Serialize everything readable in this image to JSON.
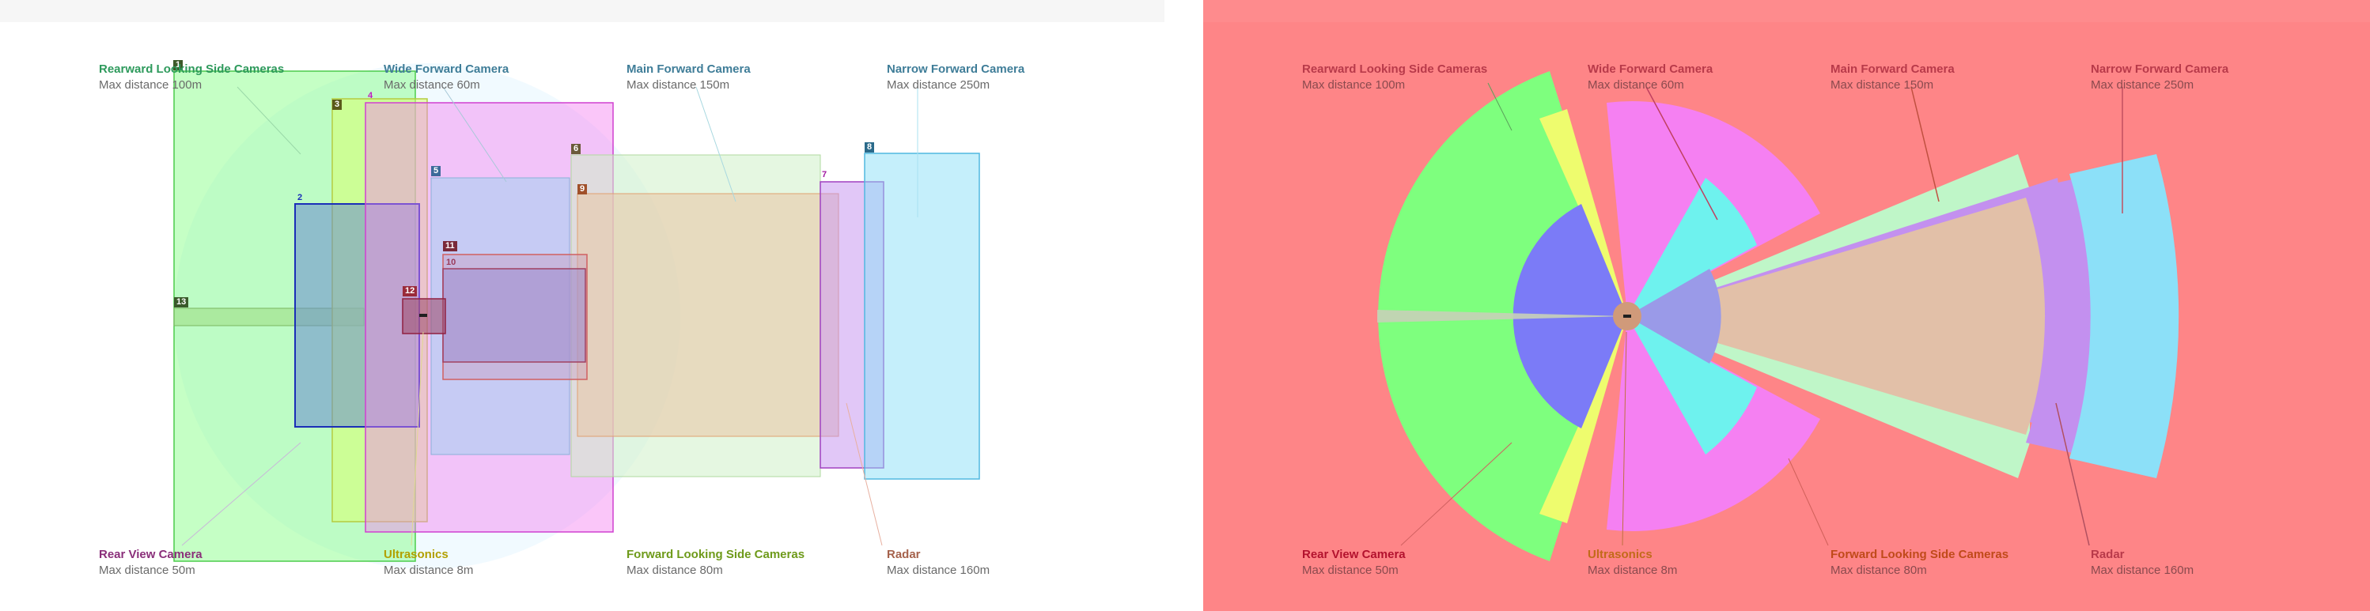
{
  "labels": [
    {
      "id": "rear-side",
      "name": "Rearward Looking Side Cameras",
      "dist": "Max distance 100m",
      "color": "#2e9a5c"
    },
    {
      "id": "wide",
      "name": "Wide Forward Camera",
      "dist": "Max distance 60m",
      "color": "#3f7d98"
    },
    {
      "id": "main",
      "name": "Main Forward Camera",
      "dist": "Max distance 150m",
      "color": "#3f7d98"
    },
    {
      "id": "narrow",
      "name": "Narrow Forward Camera",
      "dist": "Max distance 250m",
      "color": "#3f7d98"
    },
    {
      "id": "rear-view",
      "name": "Rear View Camera",
      "dist": "Max distance 50m",
      "color": "#8a2f7a"
    },
    {
      "id": "ultrasonics",
      "name": "Ultrasonics",
      "dist": "Max distance 8m",
      "color": "#b2a000"
    },
    {
      "id": "fwd-side",
      "name": "Forward Looking Side Cameras",
      "dist": "Max distance 80m",
      "color": "#6e9a1a"
    },
    {
      "id": "radar",
      "name": "Radar",
      "dist": "Max distance 160m",
      "color": "#a5624c"
    }
  ],
  "right_label_colors": {
    "rear-side": "#b83a4a",
    "wide": "#b83a4a",
    "main": "#b83a4a",
    "narrow": "#b83a4a",
    "rear-view": "#b3122e",
    "ultrasonics": "#c26a1a",
    "fwd-side": "#c04a1a",
    "radar": "#b83a4a"
  },
  "badges": [
    {
      "text": "1",
      "color": "#3d5a2a"
    },
    {
      "text": "2",
      "color": "#1a2eb8"
    },
    {
      "text": "3",
      "color": "#5a5a1a"
    },
    {
      "text": "4",
      "color": "#c01ac0"
    },
    {
      "text": "5",
      "color": "#3d6a9a"
    },
    {
      "text": "6",
      "color": "#6a5a3a"
    },
    {
      "text": "7",
      "color": "#a01aa0"
    },
    {
      "text": "8",
      "color": "#2a6a8a"
    },
    {
      "text": "9",
      "color": "#a0502a"
    },
    {
      "text": "10",
      "color": "#9a3a5a"
    },
    {
      "text": "11",
      "color": "#7a2a3a"
    },
    {
      "text": "12",
      "color": "#9a2a3a"
    },
    {
      "text": "13",
      "color": "#3a5a2a"
    }
  ],
  "colors": {
    "rear_side_fill": "#7eff7e",
    "fwd_side_fill": "#eefc6e",
    "ultrasonic_fill": "#f580f2",
    "wide_fill": "#6ef2ee",
    "rear_view_fill": "#7b7bf7",
    "main_fill": "#bff6c8",
    "radar_fill": "#c390ef",
    "narrow_fill": "#8ce0f8",
    "main_core_fill": "#e2c0a8",
    "background_right": "#fe8587"
  }
}
